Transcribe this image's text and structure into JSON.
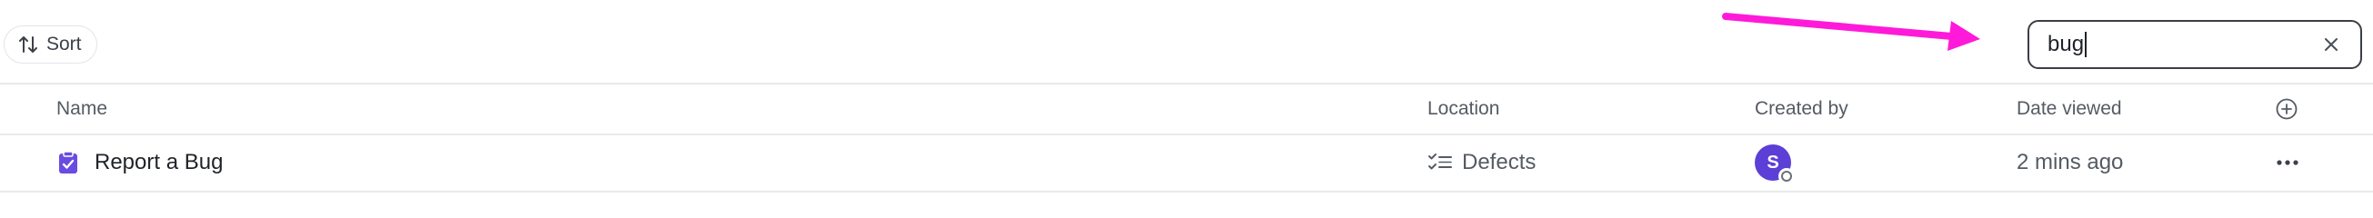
{
  "toolbar": {
    "sort_label": "Sort",
    "search": {
      "value": "bug",
      "clear_icon": "close-icon"
    },
    "annotation_arrow_color": "#ff1ad9"
  },
  "table": {
    "columns": {
      "name": "Name",
      "location": "Location",
      "created_by": "Created by",
      "date_viewed": "Date viewed"
    },
    "add_column_icon": "plus-circle-icon",
    "rows": [
      {
        "icon": "clipboard-check-icon",
        "name": "Report a Bug",
        "location_icon": "checklist-icon",
        "location": "Defects",
        "created_by_initial": "S",
        "avatar_color": "#5b3fd6",
        "date_viewed": "2 mins ago",
        "more_icon": "more-horizontal-icon"
      }
    ]
  },
  "colors": {
    "accent": "#6a4ce0",
    "border": "#e8eaed",
    "text_muted": "#555b63"
  }
}
